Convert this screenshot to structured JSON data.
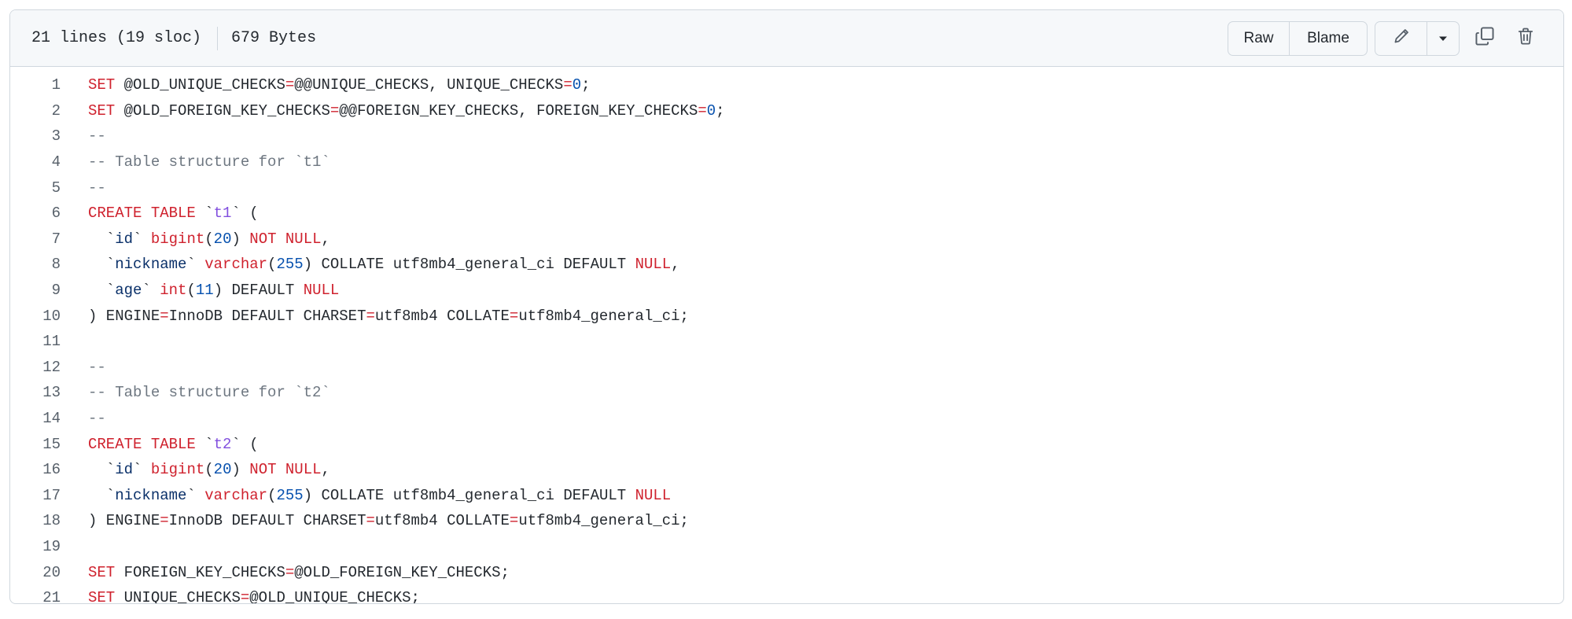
{
  "header": {
    "lines_info": "21 lines (19 sloc)",
    "size_info": "679 Bytes",
    "raw_label": "Raw",
    "blame_label": "Blame"
  },
  "icons": {
    "edit": "pencil-icon",
    "dropdown": "triangle-down-icon",
    "copy": "copy-icon",
    "delete": "trash-icon"
  },
  "colors": {
    "keyword": "#cf222e",
    "constant": "#0550ae",
    "comment": "#6e7781",
    "identifier": "#8250df",
    "text": "#24292f"
  },
  "code_lines": [
    {
      "num": "1",
      "tokens": [
        {
          "t": "SET",
          "k": "keyword"
        },
        {
          "t": " @OLD_UNIQUE_CHECKS",
          "k": "plain"
        },
        {
          "t": "=",
          "k": "keyword"
        },
        {
          "t": "@@UNIQUE_CHECKS, UNIQUE_CHECKS",
          "k": "plain"
        },
        {
          "t": "=",
          "k": "keyword"
        },
        {
          "t": "0",
          "k": "constant"
        },
        {
          "t": ";",
          "k": "plain"
        }
      ]
    },
    {
      "num": "2",
      "tokens": [
        {
          "t": "SET",
          "k": "keyword"
        },
        {
          "t": " @OLD_FOREIGN_KEY_CHECKS",
          "k": "plain"
        },
        {
          "t": "=",
          "k": "keyword"
        },
        {
          "t": "@@FOREIGN_KEY_CHECKS, FOREIGN_KEY_CHECKS",
          "k": "plain"
        },
        {
          "t": "=",
          "k": "keyword"
        },
        {
          "t": "0",
          "k": "constant"
        },
        {
          "t": ";",
          "k": "plain"
        }
      ]
    },
    {
      "num": "3",
      "tokens": [
        {
          "t": "--",
          "k": "comment"
        }
      ]
    },
    {
      "num": "4",
      "tokens": [
        {
          "t": "-- Table structure for `t1`",
          "k": "comment"
        }
      ]
    },
    {
      "num": "5",
      "tokens": [
        {
          "t": "--",
          "k": "comment"
        }
      ]
    },
    {
      "num": "6",
      "tokens": [
        {
          "t": "CREATE",
          "k": "keyword"
        },
        {
          "t": " ",
          "k": "plain"
        },
        {
          "t": "TABLE",
          "k": "keyword"
        },
        {
          "t": " `",
          "k": "plain"
        },
        {
          "t": "t1",
          "k": "ident"
        },
        {
          "t": "` (",
          "k": "plain"
        }
      ]
    },
    {
      "num": "7",
      "tokens": [
        {
          "t": "  `",
          "k": "plain"
        },
        {
          "t": "id",
          "k": "name"
        },
        {
          "t": "` ",
          "k": "plain"
        },
        {
          "t": "bigint",
          "k": "keyword"
        },
        {
          "t": "(",
          "k": "plain"
        },
        {
          "t": "20",
          "k": "constant"
        },
        {
          "t": ") ",
          "k": "plain"
        },
        {
          "t": "NOT NULL",
          "k": "keyword"
        },
        {
          "t": ",",
          "k": "plain"
        }
      ]
    },
    {
      "num": "8",
      "tokens": [
        {
          "t": "  `",
          "k": "plain"
        },
        {
          "t": "nickname",
          "k": "name"
        },
        {
          "t": "` ",
          "k": "plain"
        },
        {
          "t": "varchar",
          "k": "keyword"
        },
        {
          "t": "(",
          "k": "plain"
        },
        {
          "t": "255",
          "k": "constant"
        },
        {
          "t": ") COLLATE utf8mb4_general_ci DEFAULT ",
          "k": "plain"
        },
        {
          "t": "NULL",
          "k": "keyword"
        },
        {
          "t": ",",
          "k": "plain"
        }
      ]
    },
    {
      "num": "9",
      "tokens": [
        {
          "t": "  `",
          "k": "plain"
        },
        {
          "t": "age",
          "k": "name"
        },
        {
          "t": "` ",
          "k": "plain"
        },
        {
          "t": "int",
          "k": "keyword"
        },
        {
          "t": "(",
          "k": "plain"
        },
        {
          "t": "11",
          "k": "constant"
        },
        {
          "t": ") DEFAULT ",
          "k": "plain"
        },
        {
          "t": "NULL",
          "k": "keyword"
        }
      ]
    },
    {
      "num": "10",
      "tokens": [
        {
          "t": ") ENGINE",
          "k": "plain"
        },
        {
          "t": "=",
          "k": "keyword"
        },
        {
          "t": "InnoDB DEFAULT CHARSET",
          "k": "plain"
        },
        {
          "t": "=",
          "k": "keyword"
        },
        {
          "t": "utf8mb4 COLLATE",
          "k": "plain"
        },
        {
          "t": "=",
          "k": "keyword"
        },
        {
          "t": "utf8mb4_general_ci;",
          "k": "plain"
        }
      ]
    },
    {
      "num": "11",
      "tokens": []
    },
    {
      "num": "12",
      "tokens": [
        {
          "t": "--",
          "k": "comment"
        }
      ]
    },
    {
      "num": "13",
      "tokens": [
        {
          "t": "-- Table structure for `t2`",
          "k": "comment"
        }
      ]
    },
    {
      "num": "14",
      "tokens": [
        {
          "t": "--",
          "k": "comment"
        }
      ]
    },
    {
      "num": "15",
      "tokens": [
        {
          "t": "CREATE",
          "k": "keyword"
        },
        {
          "t": " ",
          "k": "plain"
        },
        {
          "t": "TABLE",
          "k": "keyword"
        },
        {
          "t": " `",
          "k": "plain"
        },
        {
          "t": "t2",
          "k": "ident"
        },
        {
          "t": "` (",
          "k": "plain"
        }
      ]
    },
    {
      "num": "16",
      "tokens": [
        {
          "t": "  `",
          "k": "plain"
        },
        {
          "t": "id",
          "k": "name"
        },
        {
          "t": "` ",
          "k": "plain"
        },
        {
          "t": "bigint",
          "k": "keyword"
        },
        {
          "t": "(",
          "k": "plain"
        },
        {
          "t": "20",
          "k": "constant"
        },
        {
          "t": ") ",
          "k": "plain"
        },
        {
          "t": "NOT NULL",
          "k": "keyword"
        },
        {
          "t": ",",
          "k": "plain"
        }
      ]
    },
    {
      "num": "17",
      "tokens": [
        {
          "t": "  `",
          "k": "plain"
        },
        {
          "t": "nickname",
          "k": "name"
        },
        {
          "t": "` ",
          "k": "plain"
        },
        {
          "t": "varchar",
          "k": "keyword"
        },
        {
          "t": "(",
          "k": "plain"
        },
        {
          "t": "255",
          "k": "constant"
        },
        {
          "t": ") COLLATE utf8mb4_general_ci DEFAULT ",
          "k": "plain"
        },
        {
          "t": "NULL",
          "k": "keyword"
        }
      ]
    },
    {
      "num": "18",
      "tokens": [
        {
          "t": ") ENGINE",
          "k": "plain"
        },
        {
          "t": "=",
          "k": "keyword"
        },
        {
          "t": "InnoDB DEFAULT CHARSET",
          "k": "plain"
        },
        {
          "t": "=",
          "k": "keyword"
        },
        {
          "t": "utf8mb4 COLLATE",
          "k": "plain"
        },
        {
          "t": "=",
          "k": "keyword"
        },
        {
          "t": "utf8mb4_general_ci;",
          "k": "plain"
        }
      ]
    },
    {
      "num": "19",
      "tokens": []
    },
    {
      "num": "20",
      "tokens": [
        {
          "t": "SET",
          "k": "keyword"
        },
        {
          "t": " FOREIGN_KEY_CHECKS",
          "k": "plain"
        },
        {
          "t": "=",
          "k": "keyword"
        },
        {
          "t": "@OLD_FOREIGN_KEY_CHECKS;",
          "k": "plain"
        }
      ]
    },
    {
      "num": "21",
      "tokens": [
        {
          "t": "SET",
          "k": "keyword"
        },
        {
          "t": " UNIQUE_CHECKS",
          "k": "plain"
        },
        {
          "t": "=",
          "k": "keyword"
        },
        {
          "t": "@OLD_UNIQUE_CHECKS;",
          "k": "plain"
        }
      ]
    }
  ]
}
